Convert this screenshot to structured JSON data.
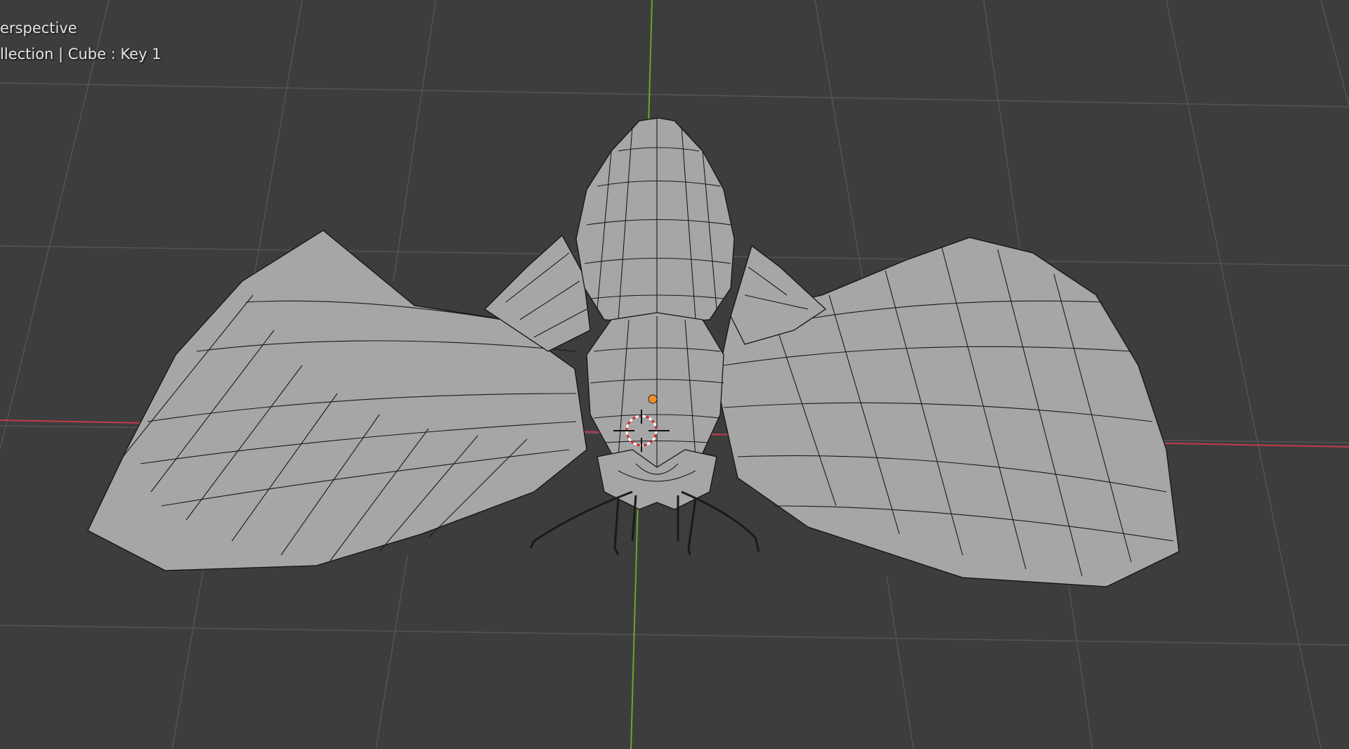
{
  "viewport": {
    "view_name": "erspective",
    "collection_info": "llection | Cube : Key 1"
  },
  "colors": {
    "background": "#3d3d3d",
    "grid": "#555555",
    "x_axis": "#c23a4a",
    "y_axis": "#6ea32b",
    "mesh_fill": "#a6a6a6",
    "origin_dot": "#f0902a",
    "cursor_ring": "#d03030"
  },
  "icons": {
    "origin": "origin-dot-icon",
    "cursor": "3d-cursor-icon"
  }
}
